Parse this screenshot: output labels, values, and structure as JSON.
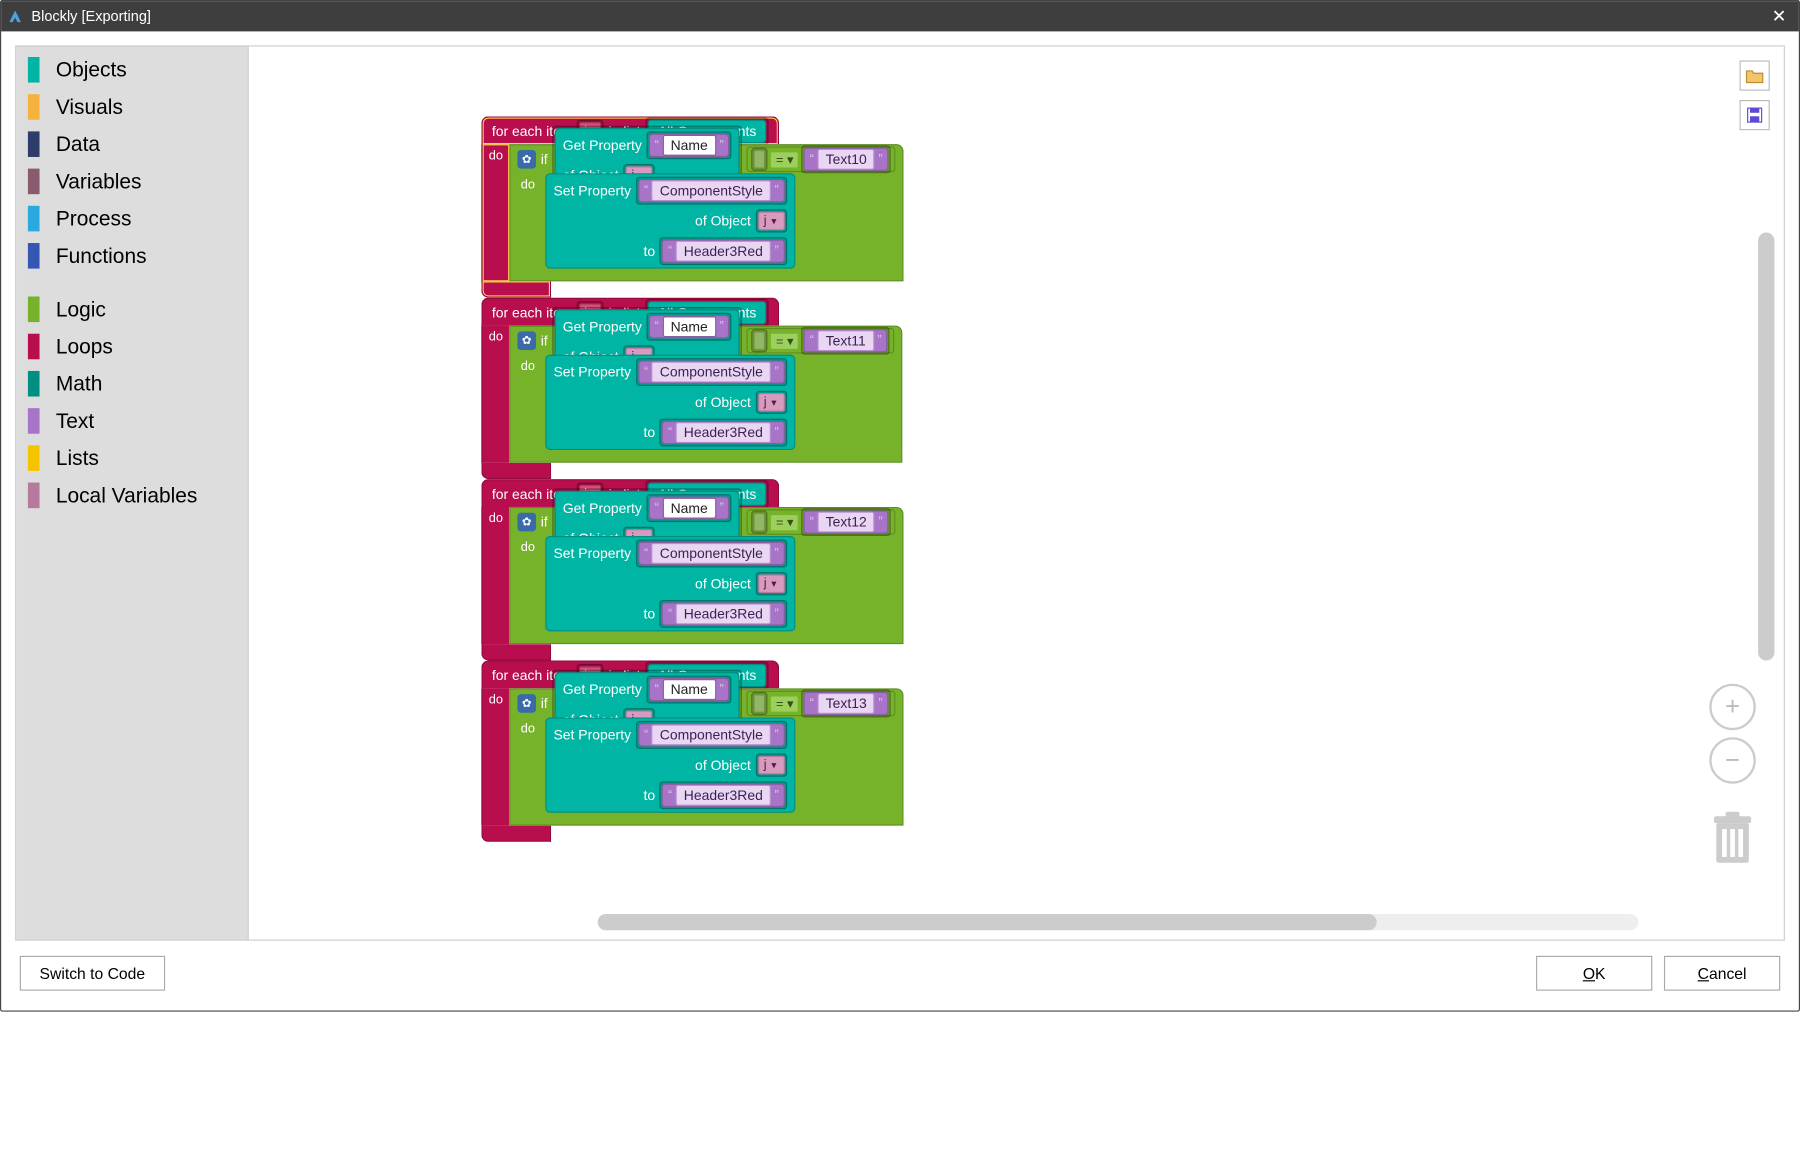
{
  "window": {
    "title": "Blockly [Exporting]"
  },
  "toolbox": {
    "items": [
      {
        "label": "Objects",
        "color": "#00b5a3"
      },
      {
        "label": "Visuals",
        "color": "#f5b23c"
      },
      {
        "label": "Data",
        "color": "#2e3c6b"
      },
      {
        "label": "Variables",
        "color": "#8a5a6f"
      },
      {
        "label": "Process",
        "color": "#2aa9e0"
      },
      {
        "label": "Functions",
        "color": "#3556b5"
      }
    ],
    "items2": [
      {
        "label": "Logic",
        "color": "#77b32a"
      },
      {
        "label": "Loops",
        "color": "#b80e4e"
      },
      {
        "label": "Math",
        "color": "#008f81"
      },
      {
        "label": "Text",
        "color": "#a874c7"
      },
      {
        "label": "Lists",
        "color": "#f5c400"
      },
      {
        "label": "Local Variables",
        "color": "#b57a9d"
      }
    ]
  },
  "labels": {
    "for_each_item": "for each item",
    "in_list": "in list",
    "all_components": "All Components",
    "do": "do",
    "if": "if",
    "get_property": "Get Property",
    "of_object": "of Object",
    "set_property": "Set Property",
    "to": "to",
    "name": "Name",
    "component_style": "ComponentStyle",
    "header3red": "Header3Red",
    "eq": "=",
    "var_j": "j"
  },
  "loops": [
    {
      "var": "j",
      "compare_value": "Text10",
      "highlight": true
    },
    {
      "var": "j",
      "compare_value": "Text11",
      "highlight": false
    },
    {
      "var": "j",
      "compare_value": "Text12",
      "highlight": false
    },
    {
      "var": "j",
      "compare_value": "Text13",
      "highlight": false
    }
  ],
  "buttons": {
    "switch_to_code": "Switch to Code",
    "ok": "OK",
    "ok_u": "O",
    "cancel": "Cancel",
    "cancel_u": "C"
  }
}
